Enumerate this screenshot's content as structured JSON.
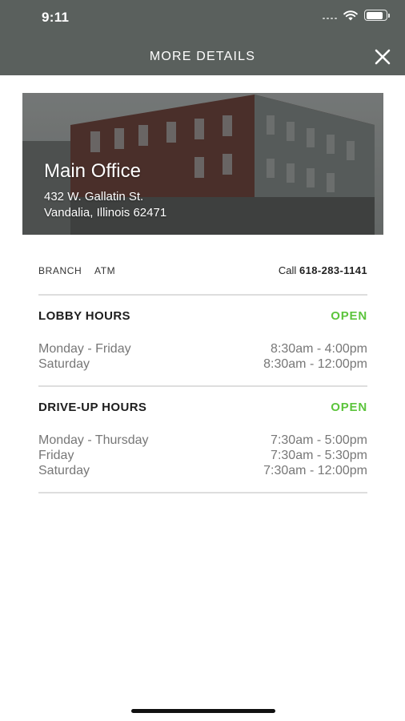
{
  "status_bar": {
    "time": "9:11"
  },
  "header": {
    "title": "MORE DETAILS"
  },
  "location": {
    "name": "Main Office",
    "address_line1": "432 W. Gallatin St.",
    "address_line2": "Vandalia, Illinois 62471"
  },
  "tabs": [
    {
      "label": "BRANCH"
    },
    {
      "label": "ATM"
    }
  ],
  "call": {
    "prefix": "Call",
    "phone": "618-283-1141"
  },
  "lobby": {
    "title": "LOBBY HOURS",
    "status": "OPEN",
    "rows": [
      {
        "day": "Monday - Friday",
        "hours": "8:30am - 4:00pm"
      },
      {
        "day": "Saturday",
        "hours": "8:30am - 12:00pm"
      }
    ]
  },
  "driveup": {
    "title": "DRIVE-UP HOURS",
    "status": "OPEN",
    "rows": [
      {
        "day": "Monday - Thursday",
        "hours": "7:30am - 5:00pm"
      },
      {
        "day": "Friday",
        "hours": "7:30am - 5:30pm"
      },
      {
        "day": "Saturday",
        "hours": "7:30am - 12:00pm"
      }
    ]
  },
  "colors": {
    "header_bg": "#5a605d",
    "open_green": "#5cc43c",
    "divider": "#dedede"
  }
}
